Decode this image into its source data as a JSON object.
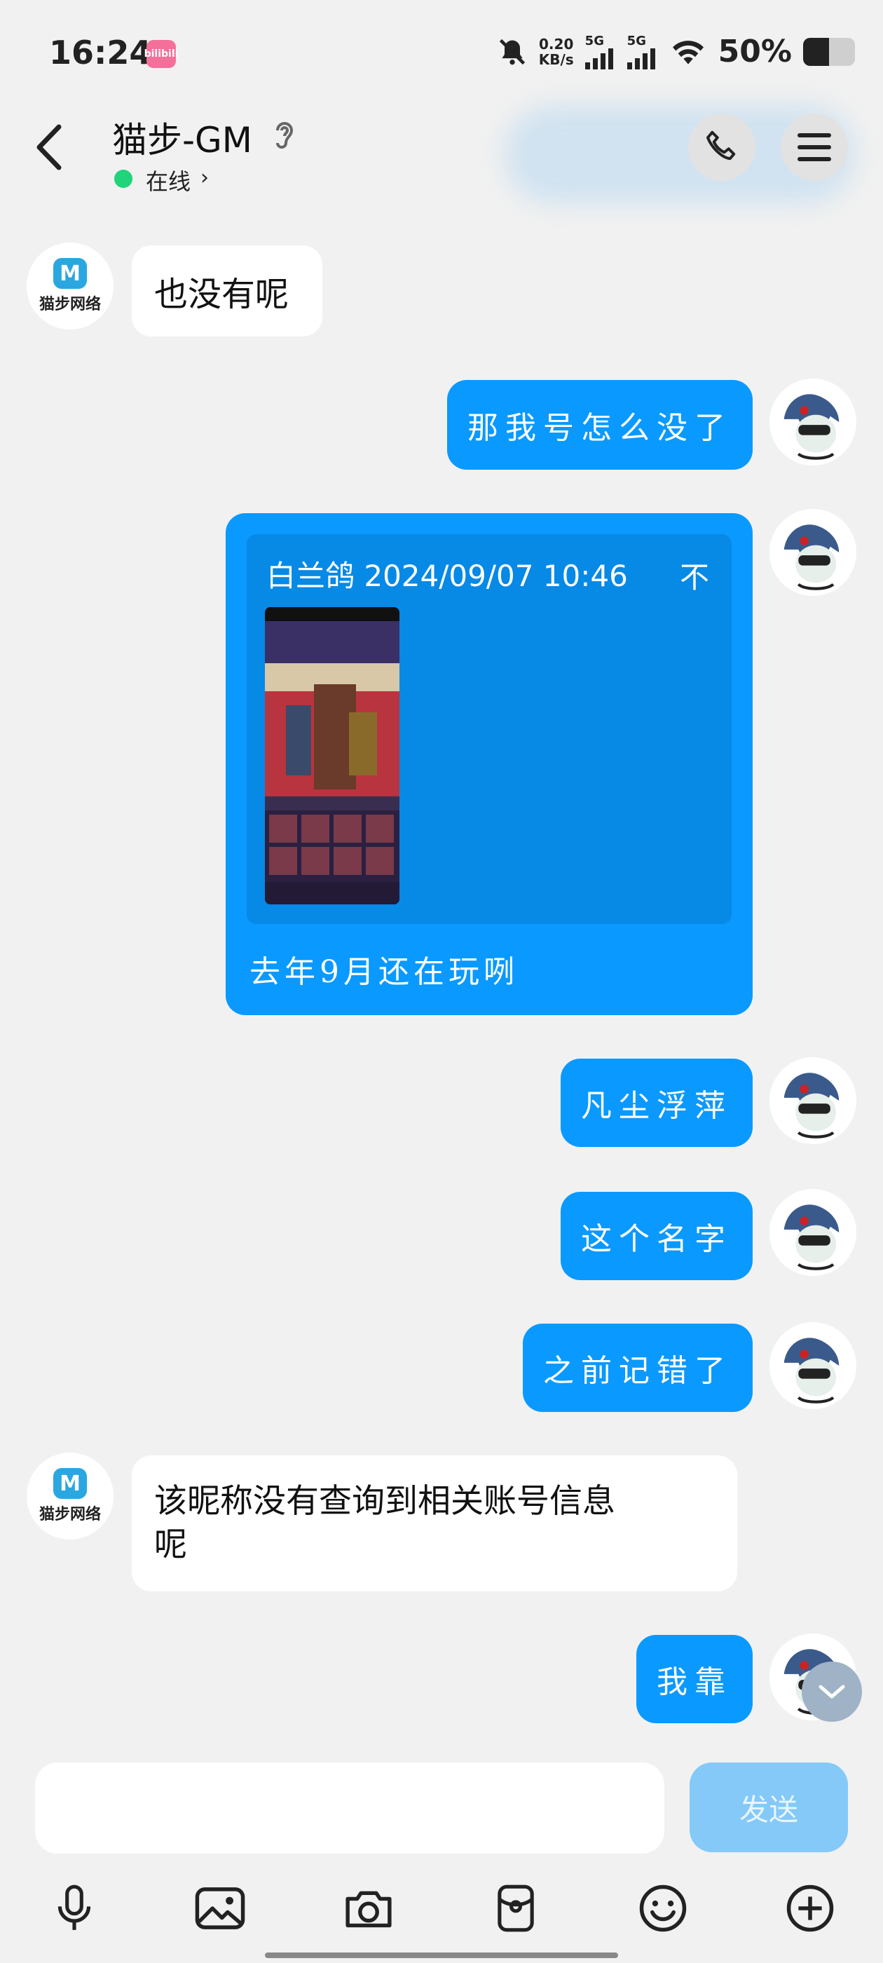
{
  "status_bar": {
    "time": "16:24",
    "app_badge": "bilibili",
    "net_speed_value": "0.20",
    "net_speed_unit": "KB/s",
    "sim1": "5G",
    "sim2": "5G",
    "battery_percent": "50%",
    "battery_level": 0.5
  },
  "header": {
    "contact_name": "猫步-GM",
    "status": "在线",
    "icons": [
      "back-arrow-icon",
      "ear-icon",
      "phone-icon",
      "menu-icon"
    ]
  },
  "gm_brand": {
    "logo_letter": "M",
    "name": "猫步网络"
  },
  "messages": [
    {
      "side": "in",
      "text": "也没有呢"
    },
    {
      "side": "out",
      "text": "那我号怎么没了"
    },
    {
      "side": "out",
      "type": "quote",
      "quote_sender_time": "白兰鸽 2024/09/07 10:46",
      "quote_arrow": "不",
      "caption": "去年9月还在玩咧"
    },
    {
      "side": "out",
      "text": "凡尘浮萍"
    },
    {
      "side": "out",
      "text": "这个名字"
    },
    {
      "side": "out",
      "text": "之前记错了"
    },
    {
      "side": "in",
      "text_line1": "该昵称没有查询到相关账号信息",
      "text_line2": "呢"
    },
    {
      "side": "out",
      "text": "我靠"
    }
  ],
  "input": {
    "placeholder": "",
    "send_label": "发送"
  },
  "toolbar": [
    "mic-icon",
    "image-icon",
    "camera-icon",
    "red-packet-icon",
    "emoji-icon",
    "plus-icon"
  ],
  "colors": {
    "outgoing_bubble": "#0a99ff",
    "incoming_bubble": "#ffffff",
    "send_button": "#84c9f7",
    "online_dot": "#1fd47a"
  }
}
